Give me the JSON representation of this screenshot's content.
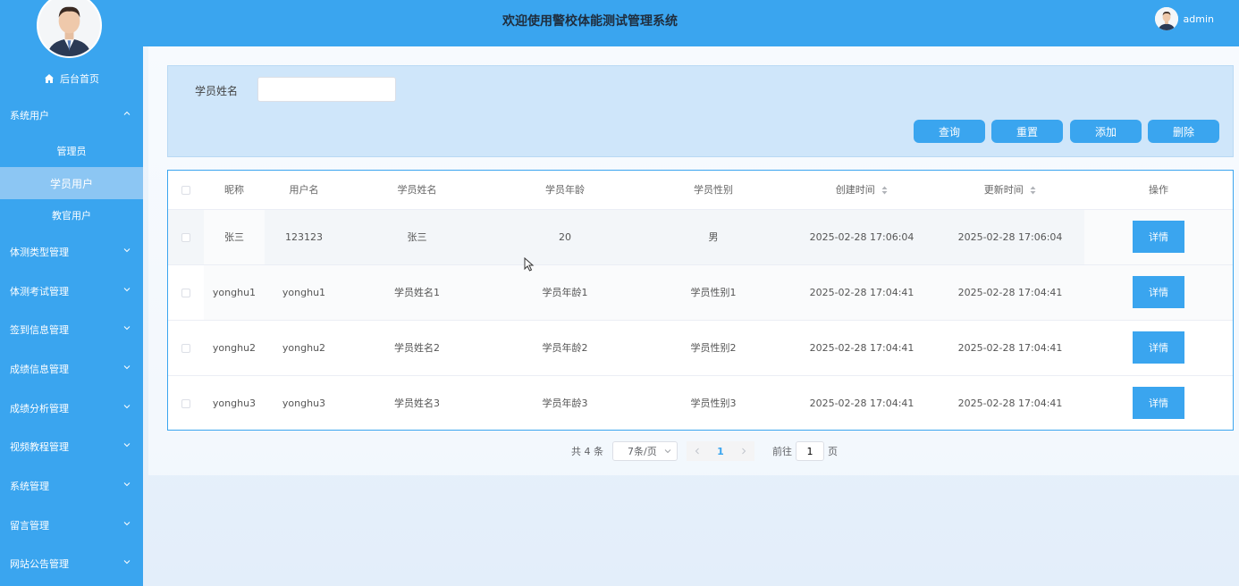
{
  "header": {
    "title": "欢迎使用警校体能测试管理系统",
    "username": "admin"
  },
  "sidebar": {
    "home_label": "后台首页",
    "system_users": "系统用户",
    "sub_items": [
      "管理员",
      "学员用户",
      "教官用户"
    ],
    "menus": [
      "体测类型管理",
      "体测考试管理",
      "签到信息管理",
      "成绩信息管理",
      "成绩分析管理",
      "视频教程管理",
      "系统管理",
      "留言管理",
      "网站公告管理"
    ]
  },
  "search": {
    "label": "学员姓名",
    "value": "",
    "placeholder": "",
    "buttons": {
      "query": "查询",
      "reset": "重置",
      "add": "添加",
      "delete": "删除"
    }
  },
  "table": {
    "headers": [
      "昵称",
      "用户名",
      "学员姓名",
      "学员年龄",
      "学员性别",
      "创建时间",
      "更新时间",
      "操作"
    ],
    "rows": [
      [
        "张三",
        "123123",
        "张三",
        "20",
        "男",
        "2025-02-28 17:06:04",
        "2025-02-28 17:06:04"
      ],
      [
        "yonghu1",
        "yonghu1",
        "学员姓名1",
        "学员年龄1",
        "学员性别1",
        "2025-02-28 17:04:41",
        "2025-02-28 17:04:41"
      ],
      [
        "yonghu2",
        "yonghu2",
        "学员姓名2",
        "学员年龄2",
        "学员性别2",
        "2025-02-28 17:04:41",
        "2025-02-28 17:04:41"
      ],
      [
        "yonghu3",
        "yonghu3",
        "学员姓名3",
        "学员年龄3",
        "学员性别3",
        "2025-02-28 17:04:41",
        "2025-02-28 17:04:41"
      ]
    ],
    "detail_label": "详情"
  },
  "pagination": {
    "total": "共 4 条",
    "page_size": "7条/页",
    "current_page": "1",
    "goto_prefix": "前往",
    "goto_value": "1",
    "goto_suffix": "页"
  },
  "colors": {
    "primary": "#3aa5ef",
    "active_sub": "#8cc6f3",
    "search_bg": "#cfe6fa"
  }
}
